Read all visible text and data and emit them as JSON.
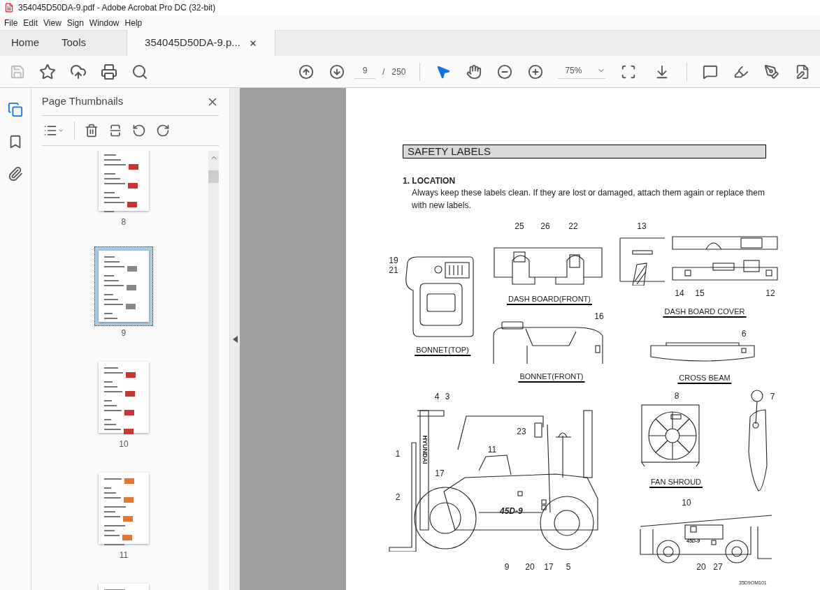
{
  "window": {
    "title": "354045D50DA-9.pdf - Adobe Acrobat Pro DC (32-bit)"
  },
  "menu": [
    "File",
    "Edit",
    "View",
    "Sign",
    "Window",
    "Help"
  ],
  "tabs": [
    {
      "label": "Home",
      "selected": false
    },
    {
      "label": "Tools",
      "selected": false
    },
    {
      "label": "354045D50DA-9.p...",
      "selected": true
    }
  ],
  "toolbar": {
    "page_current": "9",
    "page_separator": "/",
    "page_total": "250",
    "zoom": "75%"
  },
  "sidebar": {
    "title": "Page Thumbnails",
    "thumbnails": [
      {
        "label": "8",
        "selected": false
      },
      {
        "label": "9",
        "selected": true
      },
      {
        "label": "10",
        "selected": false
      },
      {
        "label": "11",
        "selected": false
      },
      {
        "selected": false
      }
    ]
  },
  "document": {
    "heading": "SAFETY LABELS",
    "section": "1. LOCATION",
    "paragraph": "Always keep these labels clean.  If they are lost or damaged, attach them again or replace them with new labels.",
    "captions": [
      "DASH BOARD(FRONT)",
      "DASH BOARD COVER",
      "BONNET(TOP)",
      "BONNET(FRONT)",
      "CROSS BEAM",
      "FAN SHROUD"
    ],
    "callouts": [
      "25",
      "26",
      "22",
      "13",
      "19",
      "21",
      "14",
      "15",
      "12",
      "16",
      "6",
      "4",
      "3",
      "8",
      "7",
      "23",
      "11",
      "1",
      "17",
      "2",
      "10",
      "9",
      "20",
      "17",
      "5",
      "20",
      "27"
    ],
    "mast_text": "HYUNDAI",
    "model_text": "45D-9",
    "small_model_text": "45D-9",
    "figure_code": "35D9OM101"
  }
}
